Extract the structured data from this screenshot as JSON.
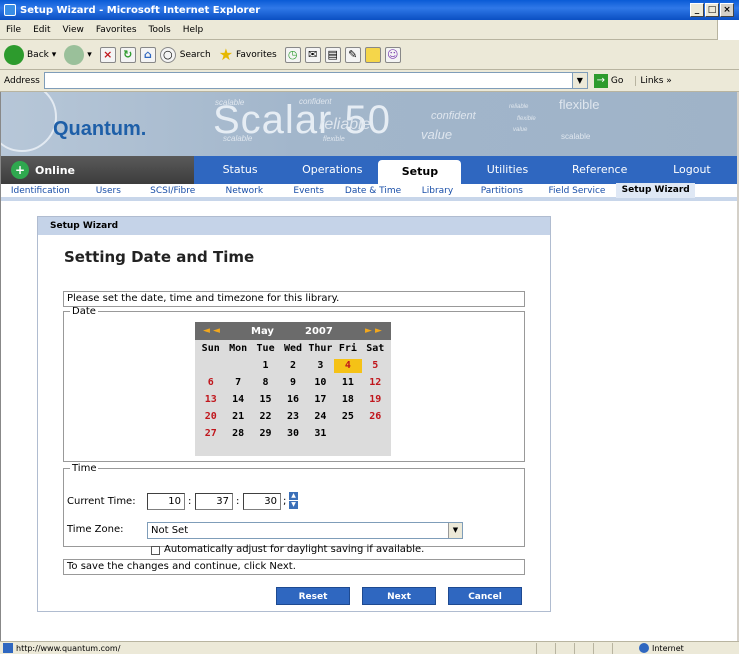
{
  "window": {
    "title": "Setup Wizard - Microsoft Internet Explorer"
  },
  "menu": [
    "File",
    "Edit",
    "View",
    "Favorites",
    "Tools",
    "Help"
  ],
  "toolbar": {
    "back": "Back",
    "search": "Search",
    "favorites": "Favorites"
  },
  "address": {
    "label": "Address",
    "value": "",
    "go": "Go",
    "links": "Links »"
  },
  "header": {
    "logo": "Quantum.",
    "product": "Scalar 50",
    "watermarks": [
      "scalable",
      "reliable",
      "value",
      "confident",
      "flexible",
      "scalable",
      "confident",
      "reliable",
      "flexible",
      "value",
      "scalable",
      "flexible"
    ]
  },
  "status": {
    "label": "Online"
  },
  "nav": {
    "tabs": [
      "Status",
      "Operations",
      "Setup",
      "Utilities",
      "Reference",
      "Logout"
    ],
    "active": "Setup"
  },
  "subnav": {
    "tabs": [
      "Identification",
      "Users",
      "SCSI/Fibre",
      "Network",
      "Events",
      "Date & Time",
      "Library",
      "Partitions",
      "Field Service",
      "Setup Wizard"
    ],
    "active": "Setup Wizard"
  },
  "wizard": {
    "header": "Setup Wizard",
    "title": "Setting Date and Time",
    "instruction": "Please set the date, time and timezone for this library.",
    "date_legend": "Date",
    "calendar": {
      "month": "May",
      "year": "2007",
      "prev": "◄ ◄",
      "next": "► ►",
      "days": [
        "Sun",
        "Mon",
        "Tue",
        "Wed",
        "Thur",
        "Fri",
        "Sat"
      ],
      "weeks": [
        [
          "",
          "",
          "1",
          "2",
          "3",
          "4",
          "5"
        ],
        [
          "6",
          "7",
          "8",
          "9",
          "10",
          "11",
          "12"
        ],
        [
          "13",
          "14",
          "15",
          "16",
          "17",
          "18",
          "19"
        ],
        [
          "20",
          "21",
          "22",
          "23",
          "24",
          "25",
          "26"
        ],
        [
          "27",
          "28",
          "29",
          "30",
          "31",
          "",
          ""
        ]
      ],
      "selected": "4"
    },
    "time_legend": "Time",
    "time": {
      "label": "Current Time:",
      "hours": "10",
      "minutes": "37",
      "seconds": "30"
    },
    "timezone": {
      "label": "Time Zone:",
      "value": "Not Set"
    },
    "dst": {
      "label": "Automatically adjust for daylight saving if available.",
      "checked": false
    },
    "footer_note": "To save the changes and continue, click Next.",
    "buttons": {
      "reset": "Reset",
      "next": "Next",
      "cancel": "Cancel"
    }
  },
  "statusbar": {
    "url": "http://www.quantum.com/",
    "zone": "Internet"
  }
}
